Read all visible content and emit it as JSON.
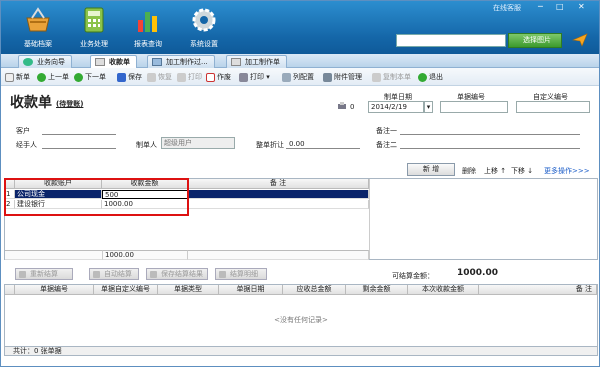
{
  "topnav": {
    "items": [
      {
        "label": "基础档案"
      },
      {
        "label": "业务处理"
      },
      {
        "label": "报表查询"
      },
      {
        "label": "系统设置"
      }
    ],
    "online_label": "在线客服",
    "choose_image_label": "选择图片"
  },
  "tabs": [
    {
      "label": "业务向导"
    },
    {
      "label": "收款单"
    },
    {
      "label": "加工制作过..."
    },
    {
      "label": "加工制作单"
    }
  ],
  "toolbar": {
    "items": [
      {
        "label": "新单"
      },
      {
        "label": "上一单"
      },
      {
        "label": "下一单"
      },
      {
        "label": "保存"
      },
      {
        "label": "恢复"
      },
      {
        "label": "打印"
      },
      {
        "label": "作废"
      },
      {
        "label": "打印 ▾"
      },
      {
        "label": "列配置"
      },
      {
        "label": "附件管理"
      },
      {
        "label": "复制本单"
      },
      {
        "label": "退出"
      }
    ]
  },
  "form": {
    "title": "收款单",
    "subtitle": "(待登账)",
    "print_count": "0",
    "date_label": "制单日期",
    "date_value": "2014/2/19",
    "doc_no_label": "单据编号",
    "custom_no_label": "自定义编号",
    "customer_label": "客户",
    "handler_label": "经手人",
    "maker_label": "制单人",
    "maker_value": "超级用户",
    "discount_label": "整单折让",
    "discount_value": "0.00",
    "note1_label": "备注一",
    "note2_label": "备注二"
  },
  "line_actions": {
    "add": "新 增",
    "delete": "删除",
    "up": "上移 ↑",
    "down": "下移 ↓",
    "more": "更多操作>>>"
  },
  "entry_grid": {
    "headers": [
      "收款账户",
      "收款金额",
      "备 注"
    ],
    "rows": [
      {
        "no": "1",
        "account": "公司现金",
        "amount": "500",
        "note": ""
      },
      {
        "no": "2",
        "account": "建设银行",
        "amount": "1000.00",
        "note": ""
      }
    ],
    "total": "1000.00"
  },
  "settle_buttons": {
    "resettle": "重新结算",
    "auto": "自动结算",
    "save_result": "保存结算结果",
    "detail": "结算明细"
  },
  "settle_amount": {
    "label": "可结算金额：",
    "value": "1000.00"
  },
  "settle_grid": {
    "headers": [
      "单据编号",
      "单据自定义编号",
      "单据类型",
      "单据日期",
      "应收总金额",
      "剩余金额",
      "本次收款金额",
      "备 注"
    ],
    "empty": "<没有任何记录>",
    "footer": "共计：0 张单据"
  }
}
